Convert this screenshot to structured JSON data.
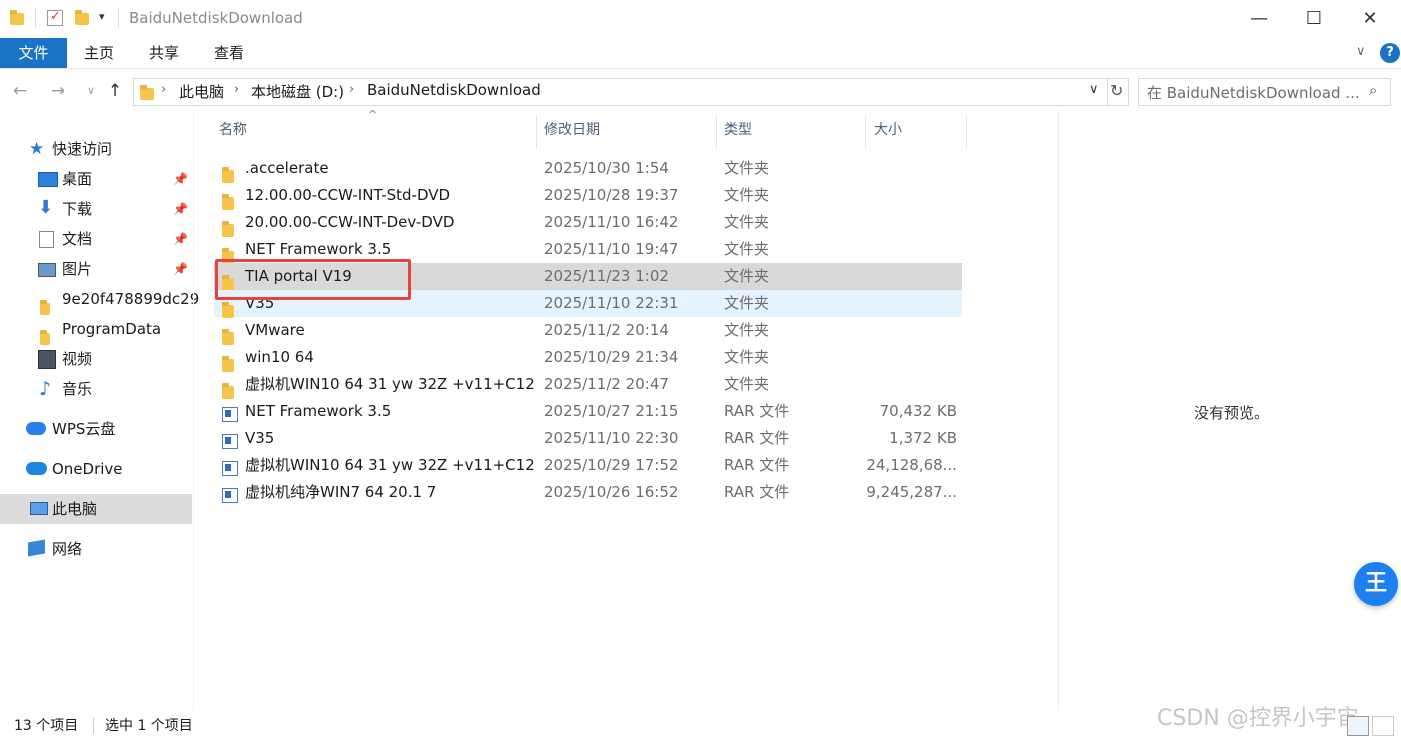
{
  "window": {
    "title": "BaiduNetdiskDownload",
    "minimize": "—",
    "maximize": "☐",
    "close": "✕"
  },
  "ribbon": {
    "file_tab": "文件",
    "tabs": [
      "主页",
      "共享",
      "查看"
    ],
    "help": "?"
  },
  "address": {
    "path": [
      "此电脑",
      "本地磁盘 (D:)",
      "BaiduNetdiskDownload"
    ],
    "search_placeholder": "在 BaiduNetdiskDownload ..."
  },
  "nav": {
    "quick_access": "快速访问",
    "items": [
      {
        "label": "桌面",
        "pinned": true,
        "icon": "desktop-icon"
      },
      {
        "label": "下载",
        "pinned": true,
        "icon": "download-icon"
      },
      {
        "label": "文档",
        "pinned": true,
        "icon": "documents-icon"
      },
      {
        "label": "图片",
        "pinned": true,
        "icon": "pictures-icon"
      },
      {
        "label": "9e20f478899dc29",
        "pinned": false,
        "icon": "folder-icon"
      },
      {
        "label": "ProgramData",
        "pinned": false,
        "icon": "folder-icon"
      },
      {
        "label": "视频",
        "pinned": false,
        "icon": "videos-icon"
      },
      {
        "label": "音乐",
        "pinned": false,
        "icon": "music-icon"
      }
    ],
    "wps": "WPS云盘",
    "onedrive": "OneDrive",
    "this_pc": "此电脑",
    "network": "网络"
  },
  "columns": {
    "name": "名称",
    "date": "修改日期",
    "type": "类型",
    "size": "大小"
  },
  "files": [
    {
      "name": ".accelerate",
      "date": "2025/10/30 1:54",
      "type": "文件夹",
      "size": "",
      "kind": "folder"
    },
    {
      "name": "12.00.00-CCW-INT-Std-DVD",
      "date": "2025/10/28 19:37",
      "type": "文件夹",
      "size": "",
      "kind": "folder"
    },
    {
      "name": "20.00.00-CCW-INT-Dev-DVD",
      "date": "2025/11/10 16:42",
      "type": "文件夹",
      "size": "",
      "kind": "folder"
    },
    {
      "name": "NET Framework 3.5",
      "date": "2025/11/10 19:47",
      "type": "文件夹",
      "size": "",
      "kind": "folder"
    },
    {
      "name": "TIA portal V19",
      "date": "2025/11/23 1:02",
      "type": "文件夹",
      "size": "",
      "kind": "folder",
      "state": "selected"
    },
    {
      "name": "V35",
      "date": "2025/11/10 22:31",
      "type": "文件夹",
      "size": "",
      "kind": "folder",
      "state": "hover"
    },
    {
      "name": "VMware",
      "date": "2025/11/2 20:14",
      "type": "文件夹",
      "size": "",
      "kind": "folder"
    },
    {
      "name": "win10 64",
      "date": "2025/10/29 21:34",
      "type": "文件夹",
      "size": "",
      "kind": "folder"
    },
    {
      "name": "虚拟机WIN10 64  31 yw 32Z +v11+C12",
      "date": "2025/11/2 20:47",
      "type": "文件夹",
      "size": "",
      "kind": "folder"
    },
    {
      "name": "NET Framework 3.5",
      "date": "2025/10/27 21:15",
      "type": "RAR 文件",
      "size": "70,432 KB",
      "kind": "rar"
    },
    {
      "name": "V35",
      "date": "2025/11/10 22:30",
      "type": "RAR 文件",
      "size": "1,372 KB",
      "kind": "rar"
    },
    {
      "name": "虚拟机WIN10 64  31 yw 32Z +v11+C12",
      "date": "2025/10/29 17:52",
      "type": "RAR 文件",
      "size": "24,128,68...",
      "kind": "rar"
    },
    {
      "name": "虚拟机纯净WIN7  64 20.1 7",
      "date": "2025/10/26 16:52",
      "type": "RAR 文件",
      "size": "9,245,287...",
      "kind": "rar"
    }
  ],
  "preview": {
    "text": "没有预览。"
  },
  "status": {
    "count": "13 个项目",
    "selected": "选中 1 个项目"
  },
  "watermark": "CSDN @控界小宇宙",
  "colors": {
    "accent": "#1a73c7",
    "selected_row": "#d9d9d9",
    "hover_row": "#e5f3ff",
    "annotation": "#e8423f"
  }
}
